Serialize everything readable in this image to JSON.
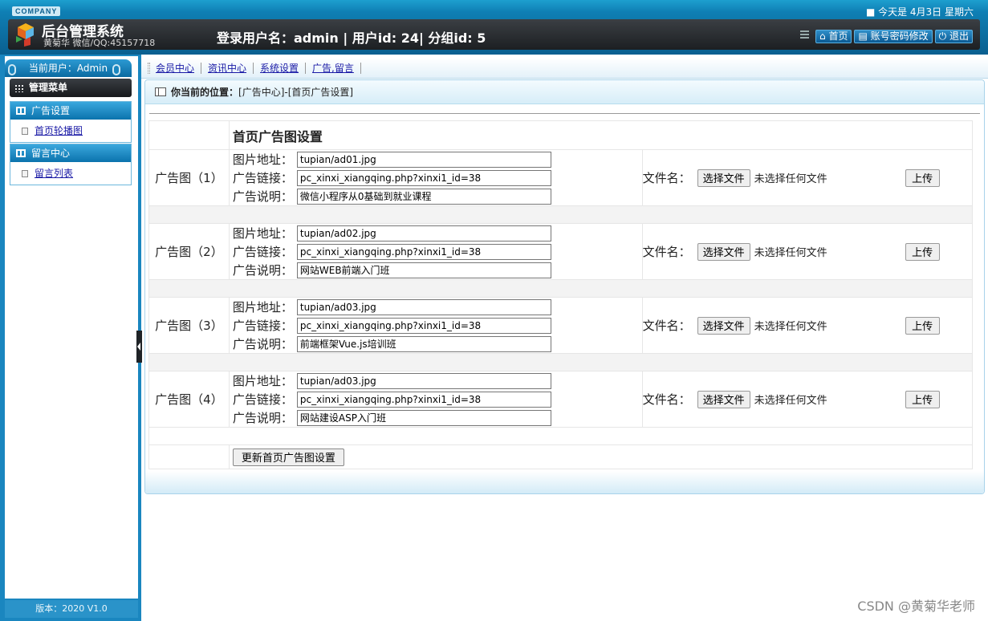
{
  "header": {
    "company": "COMPANY",
    "system_title": "后台管理系统",
    "author": "黄菊华 微信/QQ:45157718",
    "login_info": "登录用户名：admin | 用户id: 24| 分组id: 5",
    "date": "■ 今天是 4月3日 星期六",
    "buttons": {
      "home": "首页",
      "account": "账号密码修改",
      "logout": "退出"
    }
  },
  "sidebar": {
    "current_user": "当前用户：Admin",
    "menu_title": "管理菜单",
    "groups": [
      {
        "title": "广告设置",
        "items": [
          "首页轮播图"
        ]
      },
      {
        "title": "留言中心",
        "items": [
          "留言列表"
        ]
      }
    ],
    "version": "版本：2020 V1.0"
  },
  "nav": {
    "items": [
      "会员中心",
      "资讯中心",
      "系统设置",
      "广告,留言"
    ]
  },
  "breadcrumb": {
    "label": "你当前的位置：",
    "path": "[广告中心]-[首页广告设置]"
  },
  "form": {
    "title": "首页广告图设置",
    "field_labels": {
      "image": "图片地址：",
      "link": "广告链接：",
      "desc": "广告说明：",
      "file": "文件名："
    },
    "choose_file": "选择文件",
    "no_file": "未选择任何文件",
    "upload": "上传",
    "submit": "更新首页广告图设置",
    "ads": [
      {
        "label": "广告图（1）",
        "image": "tupian/ad01.jpg",
        "link": "pc_xinxi_xiangqing.php?xinxi1_id=38",
        "desc": "微信小程序从0基础到就业课程"
      },
      {
        "label": "广告图（2）",
        "image": "tupian/ad02.jpg",
        "link": "pc_xinxi_xiangqing.php?xinxi1_id=38",
        "desc": "网站WEB前端入门班"
      },
      {
        "label": "广告图（3）",
        "image": "tupian/ad03.jpg",
        "link": "pc_xinxi_xiangqing.php?xinxi1_id=38",
        "desc": "前端框架Vue.js培训班"
      },
      {
        "label": "广告图（4）",
        "image": "tupian/ad03.jpg",
        "link": "pc_xinxi_xiangqing.php?xinxi1_id=38",
        "desc": "网站建设ASP入门班"
      }
    ]
  },
  "watermark": "CSDN @黄菊华老师"
}
